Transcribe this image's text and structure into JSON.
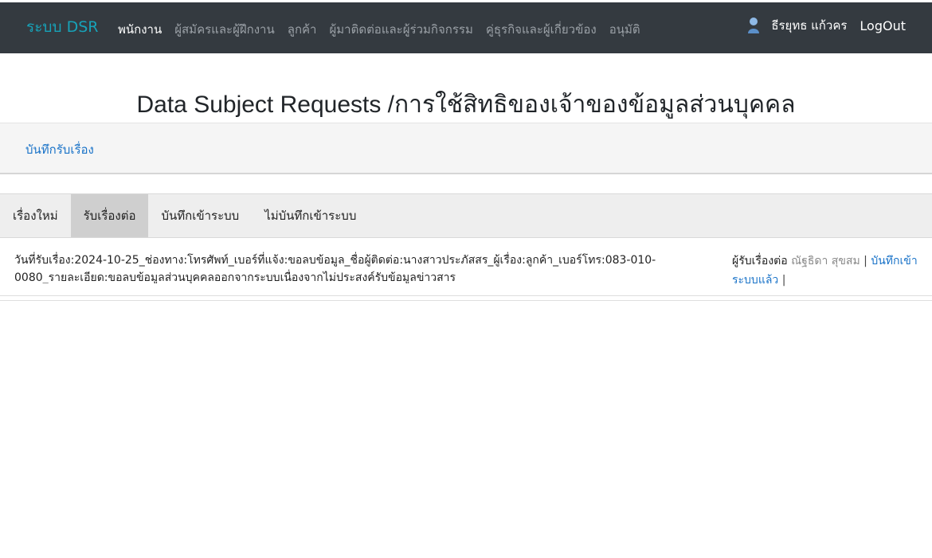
{
  "nav": {
    "brand": "ระบบ DSR",
    "links": [
      "พนักงาน",
      "ผู้สมัครและผู้ฝึกงาน",
      "ลูกค้า",
      "ผู้มาติดต่อและผู้ร่วมกิจกรรม",
      "คู่ธุรกิจและผู้เกี่ยวข้อง",
      "อนุมัติ"
    ],
    "user_name": "ธีรยุทธ แก้วคร",
    "logout": "LogOut"
  },
  "page": {
    "title": "Data Subject Requests /การใช้สิทธิของเจ้าของข้อมูลส่วนบุคคล"
  },
  "subbar": {
    "record_link": "บันทึกรับเรื่อง"
  },
  "tabs": [
    "เรื่องใหม่",
    "รับเรื่องต่อ",
    "บันทึกเข้าระบบ",
    "ไม่บันทึกเข้าระบบ"
  ],
  "record": {
    "date_label": "วันที่รับเรื่อง:",
    "text": "2024-10-25_ช่องทาง:โทรศัพท์_เบอร์ที่แจ้ง:ขอลบข้อมูล_ชื่อผู้ติดต่อ:นางสาวประภัสสร_ผู้เรื่อง:ลูกค้า_เบอร์โทร:083-010-0080_รายละเอียด:ขอลบข้อมูลส่วนบุคคลออกจากระบบเนื่องจากไม่ประสงค์รับข้อมูลข่าวสาร",
    "responder_label": "ผู้รับเรื่องต่อ",
    "responder_name": "ณัฐธิดา สุขสม",
    "sep": "|",
    "saved_link": "บันทึกเข้าระบบแล้ว",
    "trailing_sep": "|"
  }
}
